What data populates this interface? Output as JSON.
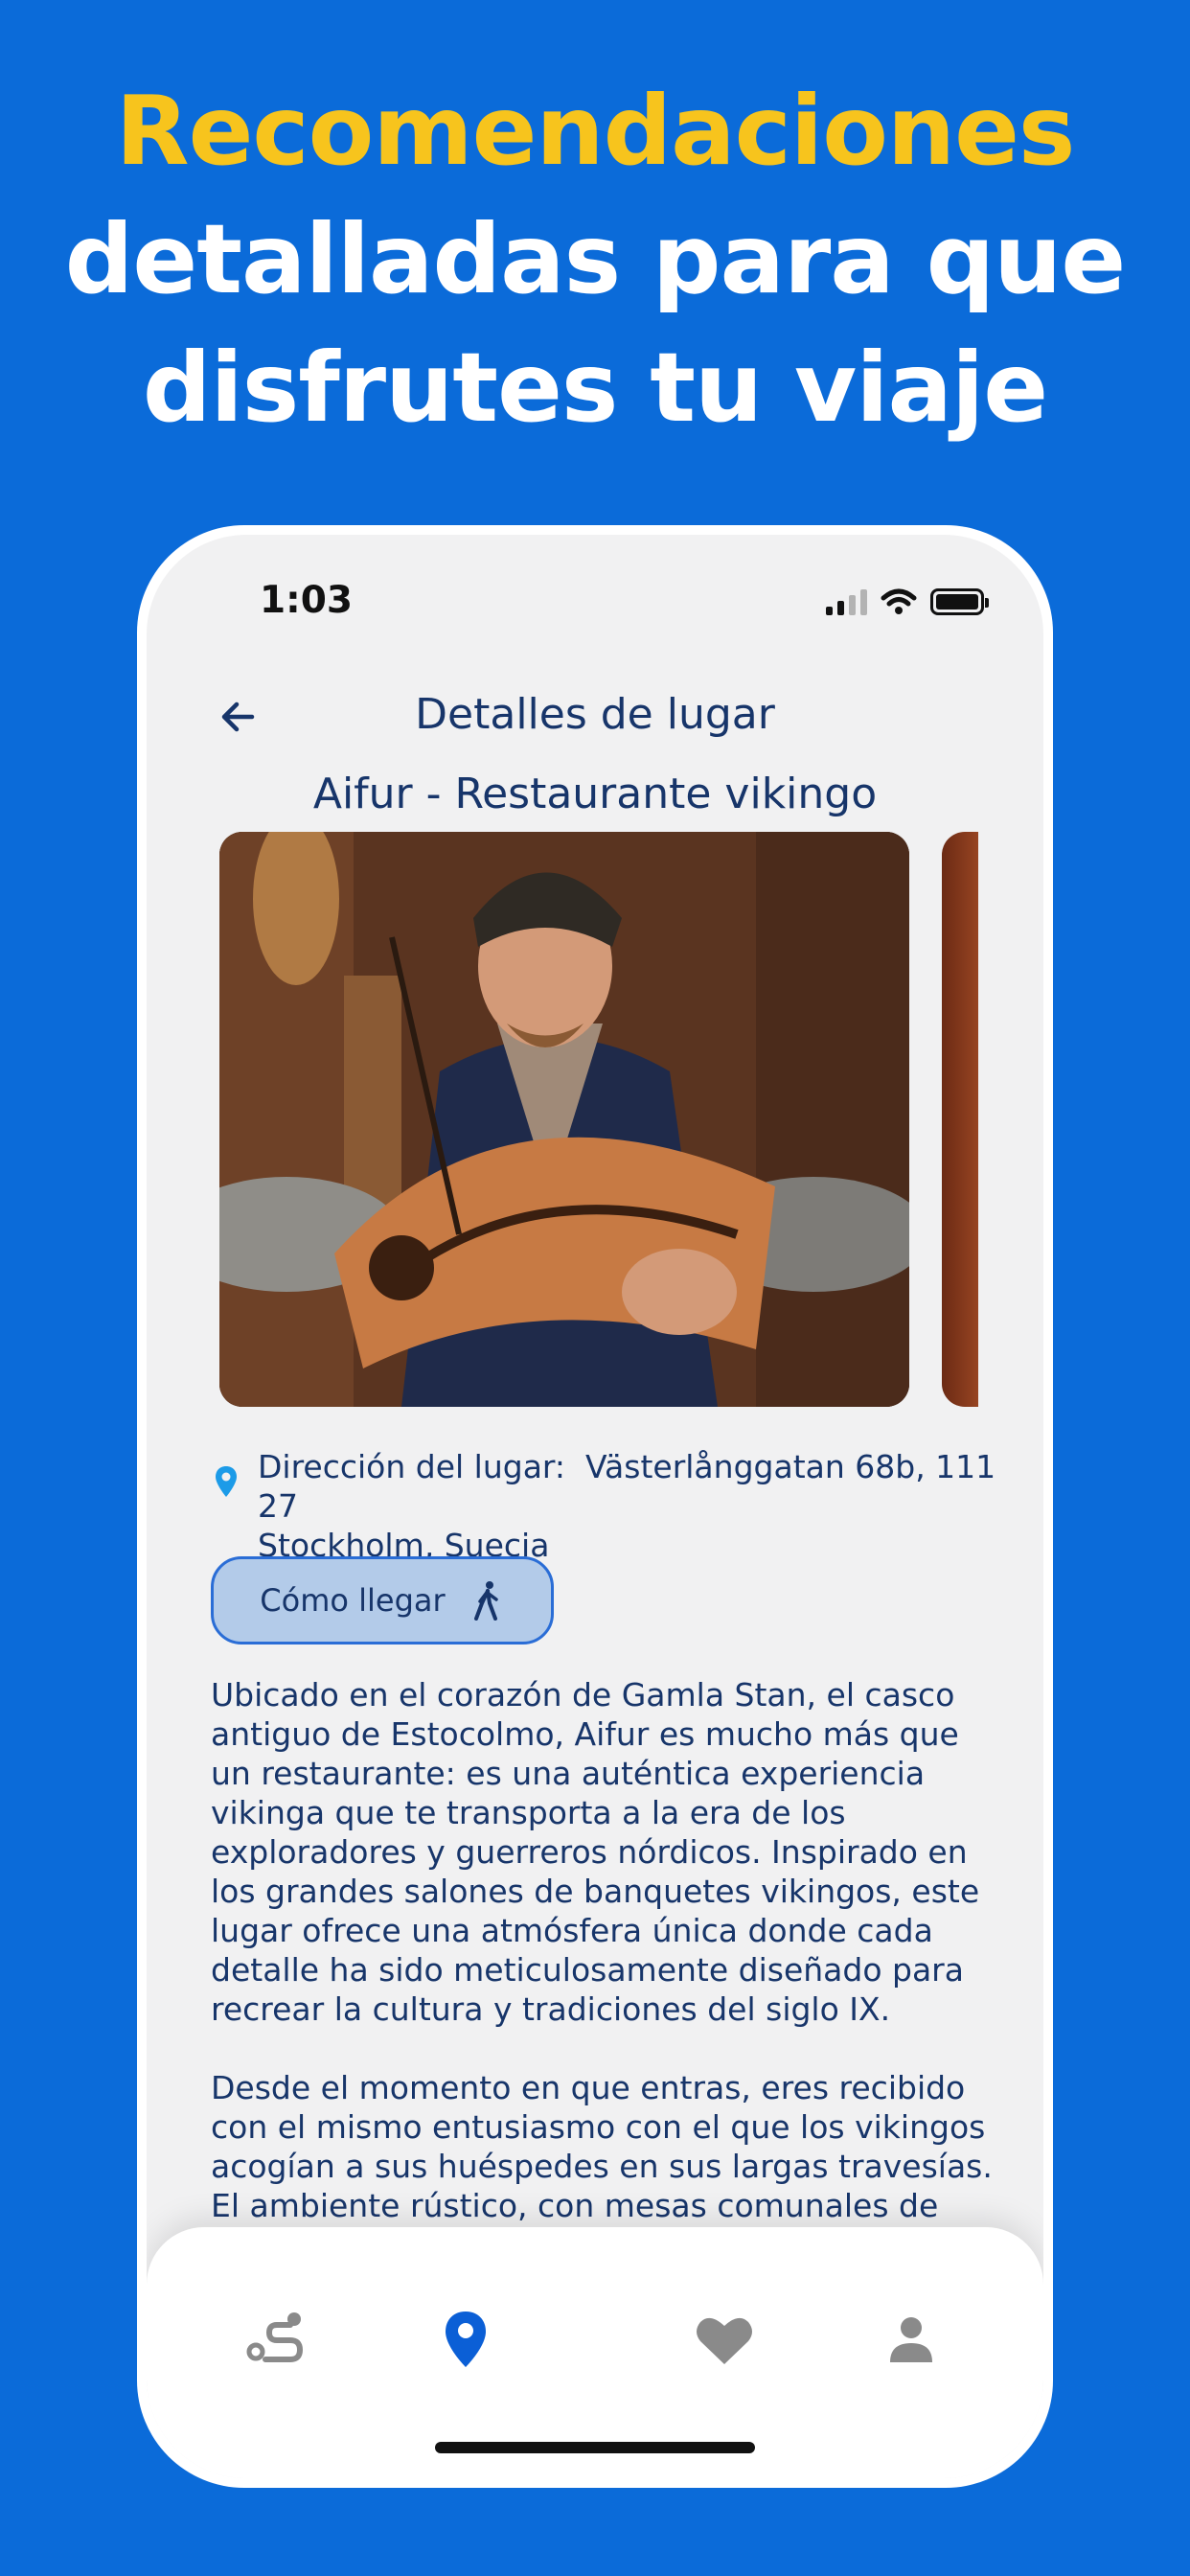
{
  "headline": {
    "line1": "Recomendaciones",
    "line2": "detalladas para que",
    "line3": "disfrutes tu viaje"
  },
  "status_bar": {
    "time": "1:03"
  },
  "header": {
    "title": "Detalles de lugar"
  },
  "place": {
    "name": "Aifur - Restaurante vikingo",
    "address_label": "Dirección del lugar:",
    "address_line1": "Västerlånggatan 68b, 111 27",
    "address_line2": "Stockholm, Suecia"
  },
  "directions_button": {
    "label": "Cómo llegar"
  },
  "description": {
    "paragraph1": "Ubicado en el corazón de Gamla Stan, el casco antiguo de Estocolmo, Aifur es mucho más que un restaurante: es una auténtica experiencia vikinga que te transporta a la era de los exploradores y guerreros nórdicos. Inspirado en los grandes salones de banquetes vikingos, este lugar ofrece una atmósfera única donde cada detalle ha sido meticulosamente diseñado para recrear la cultura y tradiciones del siglo IX.",
    "paragraph2": "Desde el momento en que entras, eres recibido con el mismo entusiasmo con el que los vikingos acogían a sus huéspedes en sus largas travesías. El ambiente rústico, con mesas comunales de madera maciza, iluminación tenue de antorchas y música"
  },
  "bottom_nav": {
    "items": [
      {
        "icon": "route-icon",
        "active": false
      },
      {
        "icon": "location-pin-icon",
        "active": true
      },
      {
        "icon": "heart-icon",
        "active": false
      },
      {
        "icon": "person-icon",
        "active": false
      }
    ]
  },
  "colors": {
    "background": "#0b6bd9",
    "headline_accent": "#f7c41d",
    "text_primary": "#17356a",
    "active_nav": "#0b5fd6",
    "inactive_nav": "#8a8a8a",
    "button_fill": "#b3cbe9"
  }
}
